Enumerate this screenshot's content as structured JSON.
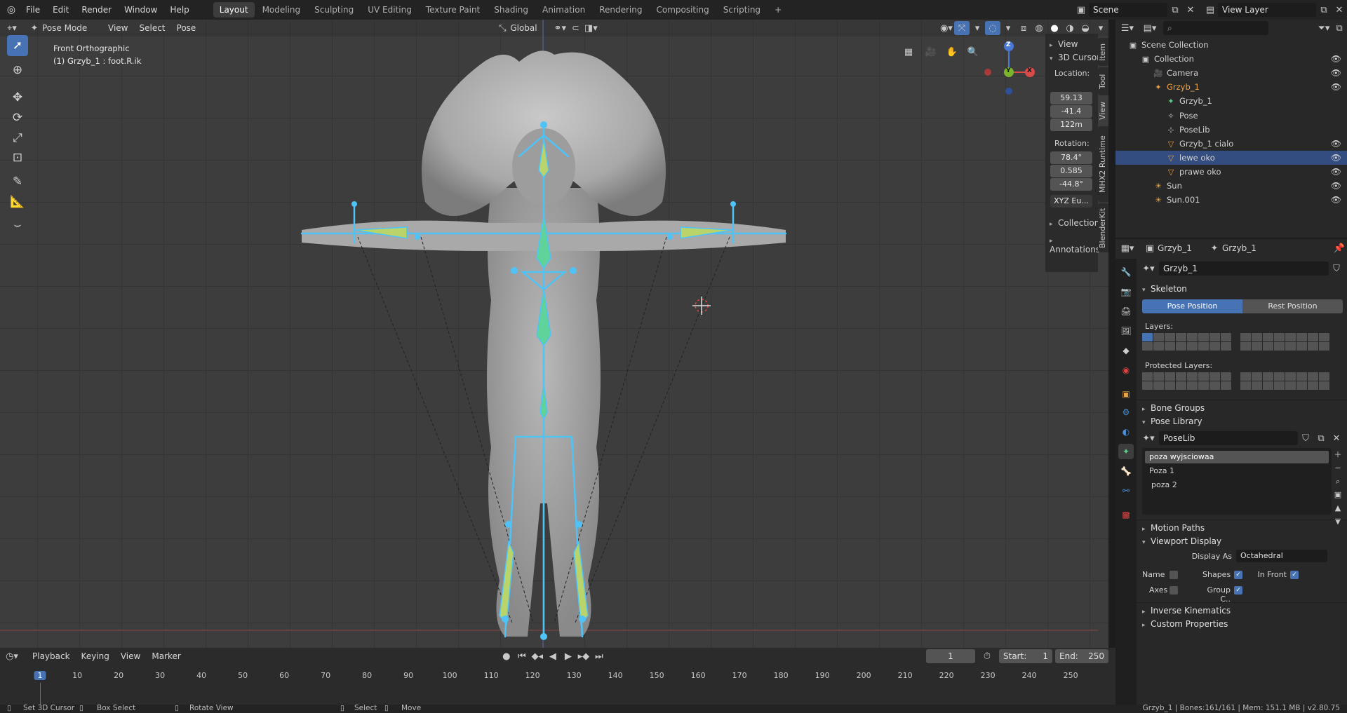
{
  "topbar": {
    "menus": [
      "File",
      "Edit",
      "Render",
      "Window",
      "Help"
    ],
    "workspaces": [
      "Layout",
      "Modeling",
      "Sculpting",
      "UV Editing",
      "Texture Paint",
      "Shading",
      "Animation",
      "Rendering",
      "Compositing",
      "Scripting"
    ],
    "active_workspace": "Layout",
    "add_tab": "+",
    "scene": "Scene",
    "view_layer": "View Layer"
  },
  "viewport": {
    "mode": "Pose Mode",
    "menus": [
      "View",
      "Select",
      "Pose"
    ],
    "orientation": "Global",
    "view_name": "Front Orthographic",
    "object_info": "(1) Grzyb_1 : foot.R.ik",
    "gizmo": {
      "z": "Z",
      "y": "Y",
      "x": "X"
    },
    "side_tabs": [
      "Item",
      "Tool",
      "View",
      "MHX2 Runtime",
      "BlenderKit"
    ],
    "npanel": {
      "view_label": "View",
      "cursor_label": "3D Cursor",
      "location_label": "Location:",
      "location": [
        "59.13",
        "-41.4",
        "122m"
      ],
      "rotation_label": "Rotation:",
      "rotation": [
        "78.4°",
        "0.585",
        "-44.8°"
      ],
      "rotation_mode": "XYZ Eu...",
      "collections_label": "Collections",
      "annotations_label": "Annotations"
    }
  },
  "outliner": {
    "search_placeholder": "",
    "rows": [
      {
        "label": "Scene Collection",
        "icon": "scene-collection-icon",
        "indent": 0,
        "eye": false,
        "color": "#d0d0d0"
      },
      {
        "label": "Collection",
        "icon": "collection-icon",
        "indent": 1,
        "eye": true,
        "color": "#d0d0d0"
      },
      {
        "label": "Camera",
        "icon": "camera-icon",
        "indent": 2,
        "eye": true,
        "color": "#d0d0d0"
      },
      {
        "label": "Grzyb_1",
        "icon": "armature-icon",
        "indent": 2,
        "eye": true,
        "color": "#e8a345"
      },
      {
        "label": "Grzyb_1",
        "icon": "armature-data-icon",
        "indent": 3,
        "eye": false,
        "color": "#d0d0d0"
      },
      {
        "label": "Pose",
        "icon": "pose-icon",
        "indent": 3,
        "eye": false,
        "color": "#d0d0d0"
      },
      {
        "label": "PoseLib",
        "icon": "poselib-icon",
        "indent": 3,
        "eye": false,
        "color": "#d0d0d0"
      },
      {
        "label": "Grzyb_1 cialo",
        "icon": "mesh-icon",
        "indent": 3,
        "eye": true,
        "color": "#d0d0d0"
      },
      {
        "label": "lewe oko",
        "icon": "mesh-icon",
        "indent": 3,
        "eye": true,
        "color": "#d0d0d0",
        "selected": true
      },
      {
        "label": "prawe oko",
        "icon": "mesh-icon",
        "indent": 3,
        "eye": true,
        "color": "#d0d0d0"
      },
      {
        "label": "Sun",
        "icon": "light-icon",
        "indent": 2,
        "eye": true,
        "color": "#d0d0d0"
      },
      {
        "label": "Sun.001",
        "icon": "light-icon",
        "indent": 2,
        "eye": true,
        "color": "#d0d0d0"
      }
    ]
  },
  "properties": {
    "breadcrumb": [
      "Grzyb_1",
      "Grzyb_1"
    ],
    "data_name": "Grzyb_1",
    "skeleton_label": "Skeleton",
    "pose_position": "Pose Position",
    "rest_position": "Rest Position",
    "layers_label": "Layers:",
    "protected_layers_label": "Protected Layers:",
    "bone_groups": "Bone Groups",
    "pose_library": "Pose Library",
    "poselib_name": "PoseLib",
    "poses": [
      "poza wyjsciowaa",
      "Poza 1",
      "poza 2"
    ],
    "motion_paths": "Motion Paths",
    "viewport_display": "Viewport Display",
    "display_as_label": "Display As",
    "display_as": "Octahedral",
    "name_label": "Name",
    "shapes_label": "Shapes",
    "in_front_label": "In Front",
    "axes_label": "Axes",
    "group_colors_label": "Group C..",
    "inverse_kinematics": "Inverse Kinematics",
    "custom_properties": "Custom Properties"
  },
  "timeline": {
    "menus": [
      "Playback",
      "Keying",
      "View",
      "Marker"
    ],
    "current_frame": "1",
    "start_label": "Start:",
    "start": "1",
    "end_label": "End:",
    "end": "250",
    "ruler": [
      "1",
      "10",
      "20",
      "30",
      "40",
      "50",
      "60",
      "70",
      "80",
      "90",
      "100",
      "110",
      "120",
      "130",
      "140",
      "150",
      "160",
      "170",
      "180",
      "190",
      "200",
      "210",
      "220",
      "230",
      "240",
      "250"
    ]
  },
  "statusbar": {
    "hints": [
      "Set 3D Cursor",
      "Box Select",
      "Rotate View",
      "Select",
      "Move"
    ],
    "stats": "Grzyb_1 | Bones:161/161 | Mem: 151.1 MB | v2.80.75"
  },
  "colors": {
    "accent": "#4772b3",
    "bone": "#4fc3f7",
    "selected_object": "#e8a345"
  }
}
